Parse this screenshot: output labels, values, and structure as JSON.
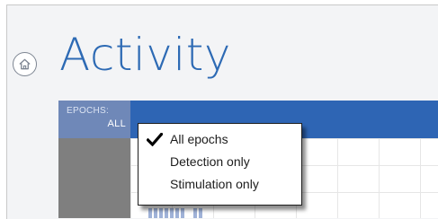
{
  "page": {
    "title": "Activity",
    "home_icon": "home-icon"
  },
  "epochs": {
    "label": "EPOCHS:",
    "value": "ALL"
  },
  "menu": {
    "items": [
      {
        "label": "All epochs",
        "checked": true
      },
      {
        "label": "Detection only",
        "checked": false
      },
      {
        "label": "Stimulation only",
        "checked": false
      }
    ],
    "check_icon": "checkmark-icon"
  },
  "colors": {
    "title": "#2d6ab4",
    "header_bar": "#2e65b4",
    "epoch_selector": "#6f88b8",
    "side_panel": "#7f7f7f"
  }
}
